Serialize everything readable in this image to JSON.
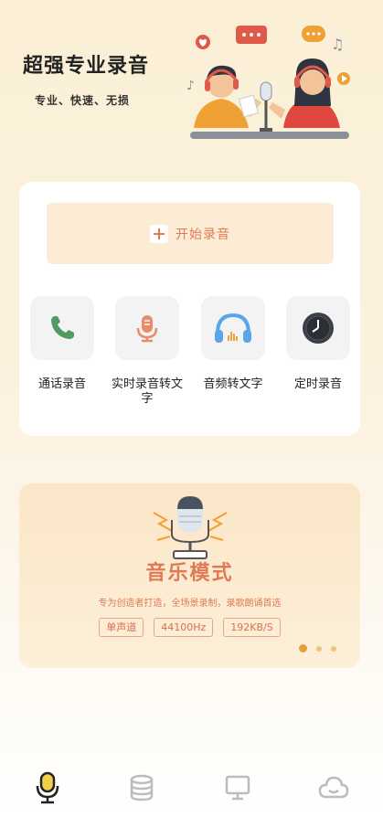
{
  "header": {
    "title": "超强专业录音",
    "subtitle": "专业、快速、无损"
  },
  "start": {
    "label": "开始录音",
    "icon": "plus-icon"
  },
  "features": [
    {
      "label": "通话录音",
      "icon": "phone-icon"
    },
    {
      "label": "实时录音转文字",
      "icon": "microphone-icon"
    },
    {
      "label": "音频转文字",
      "icon": "headphones-icon"
    },
    {
      "label": "定时录音",
      "icon": "clock-icon"
    }
  ],
  "banner": {
    "title": "音乐模式",
    "description": "专为创造者打造，全场景录制，录歌朗诵首选",
    "tags": [
      "单声道",
      "44100Hz",
      "192KB/S"
    ],
    "active_dot": 1,
    "dot_count": 3
  },
  "nav": [
    {
      "icon": "microphone-icon",
      "active": true
    },
    {
      "icon": "database-icon",
      "active": false
    },
    {
      "icon": "monitor-icon",
      "active": false
    },
    {
      "icon": "cloud-icon",
      "active": false
    }
  ],
  "colors": {
    "accent": "#e07a55",
    "accent_light": "#fcebd5",
    "gold": "#e0a33a",
    "nav_inactive": "#bcbcbc"
  }
}
